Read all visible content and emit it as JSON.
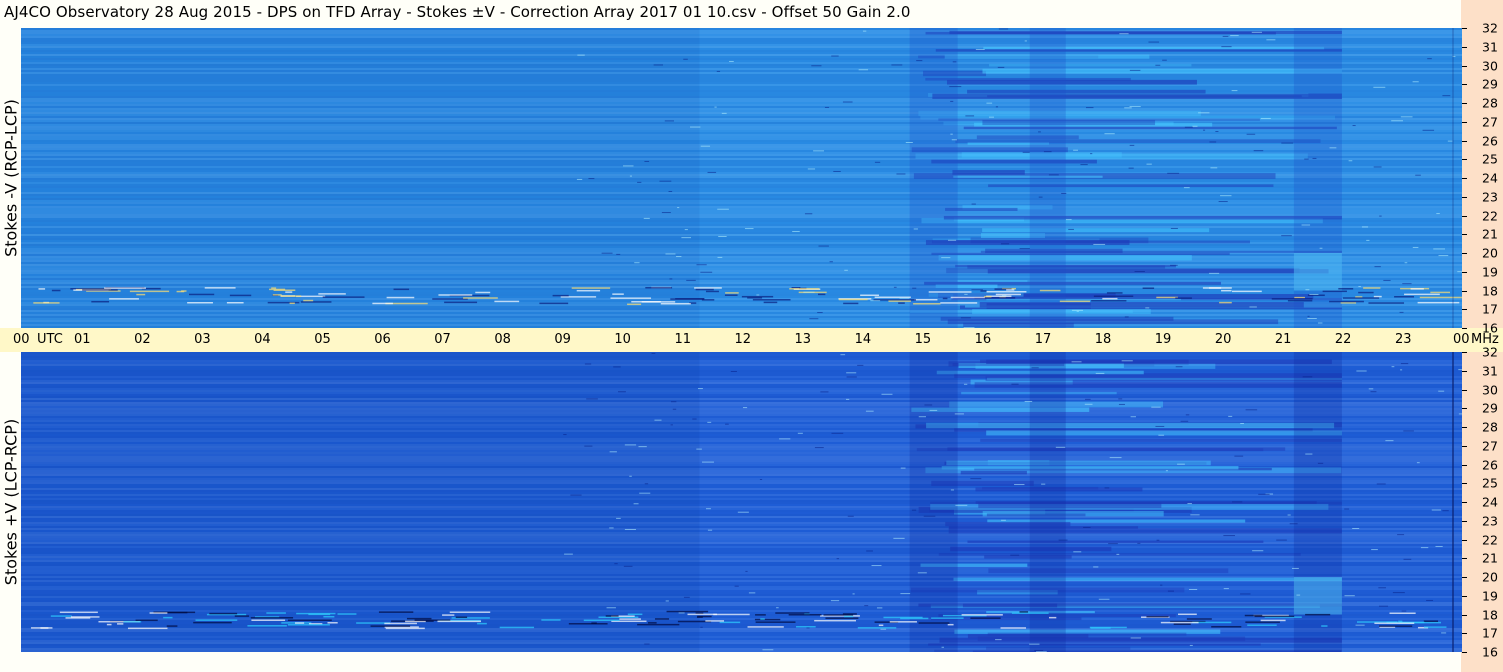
{
  "title": "AJ4CO Observatory  28 Aug 2015  -  DPS on TFD Array  -  Stokes ±V  -  Correction Array 2017 01 10.csv  -  Offset 50  Gain 2.0",
  "chart_data": [
    {
      "type": "heatmap",
      "panel": "top",
      "ylabel": "Stokes -V (RCP-LCP)",
      "x_ticks": [
        "00",
        "01",
        "02",
        "03",
        "04",
        "05",
        "06",
        "07",
        "08",
        "09",
        "10",
        "11",
        "12",
        "13",
        "14",
        "15",
        "16",
        "17",
        "18",
        "19",
        "20",
        "21",
        "22",
        "23",
        "00"
      ],
      "x_unit_first": "UTC",
      "xlim": [
        0,
        24
      ],
      "y_ticks": [
        "32",
        "31",
        "30",
        "29",
        "28",
        "27",
        "26",
        "25",
        "24",
        "23",
        "22",
        "21",
        "20",
        "19",
        "18",
        "17",
        "16"
      ],
      "y_unit": "MHz",
      "ylim": [
        16,
        32
      ],
      "base_color": "#2a8ee6",
      "active_region_utc": [
        14.8,
        22.0
      ],
      "strong_band_mhz": [
        17.3,
        18.2
      ]
    },
    {
      "type": "heatmap",
      "panel": "bottom",
      "ylabel": "Stokes +V (LCP-RCP)",
      "x_ticks": [
        "00",
        "01",
        "02",
        "03",
        "04",
        "05",
        "06",
        "07",
        "08",
        "09",
        "10",
        "11",
        "12",
        "13",
        "14",
        "15",
        "16",
        "17",
        "18",
        "19",
        "20",
        "21",
        "22",
        "23",
        "00"
      ],
      "xlim": [
        0,
        24
      ],
      "y_ticks": [
        "32",
        "31",
        "30",
        "29",
        "28",
        "27",
        "26",
        "25",
        "24",
        "23",
        "22",
        "21",
        "20",
        "19",
        "18",
        "17",
        "16"
      ],
      "y_unit": "MHz",
      "ylim": [
        16,
        32
      ],
      "base_color": "#1f5fd8",
      "active_region_utc": [
        14.8,
        22.0
      ],
      "strong_band_mhz": [
        17.3,
        18.2
      ]
    }
  ],
  "axis": {
    "utc_label": "UTC",
    "mhz_label": "MHz"
  }
}
